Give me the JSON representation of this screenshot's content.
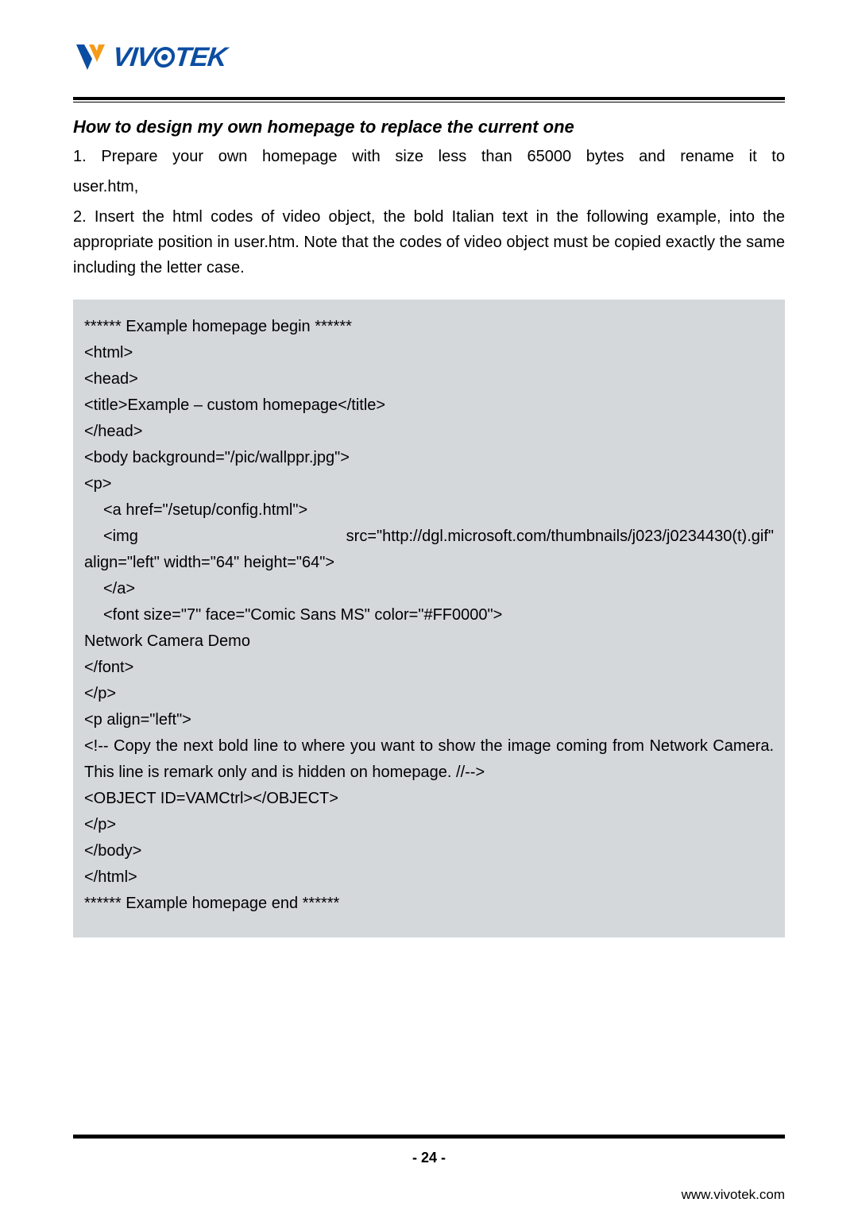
{
  "logo": {
    "brand": "VIVOTEK",
    "v1": "VIV",
    "v2": "TEK"
  },
  "heading": "How to design my own homepage to replace the current one",
  "para1": "1. Prepare your own homepage with size less than 65000 bytes and rename it to user.htm,",
  "para2": "2. Insert the html codes of video object, the bold Italian text in the following example, into the appropriate position in user.htm. Note that the codes of video object must be copied exactly the same including the letter case.",
  "code": {
    "l01": "****** Example homepage begin ******",
    "l02": "<html>",
    "l03": "<head>",
    "l04": "<title>Example – custom homepage</title>",
    "l05": "</head>",
    "l06": "<body background=\"/pic/wallppr.jpg\">",
    "l07": "<p>",
    "l08": "<a href=\"/setup/config.html\">",
    "l09a": "<img",
    "l09b": "src=\"http://dgl.microsoft.com/thumbnails/j023/j0234430(t).gif\"",
    "l10": "align=\"left\" width=\"64\" height=\"64\">",
    "l11": "</a>",
    "l12": "<font size=\"7\" face=\"Comic Sans MS\" color=\"#FF0000\">",
    "l13": "Network Camera Demo",
    "l14": "</font>",
    "l15": "</p>",
    "l16": "<p align=\"left\">",
    "l17": "<!-- Copy the next bold line to where you want to show the image coming from Network Camera. This line is remark only and is hidden on homepage. //-->",
    "l18": "<OBJECT ID=VAMCtrl></OBJECT>",
    "l19": "</p>",
    "l20": "</body>",
    "l21": "</html>",
    "l22": "****** Example homepage end ******"
  },
  "page_number": "- 24 -",
  "site_url": "www.vivotek.com"
}
